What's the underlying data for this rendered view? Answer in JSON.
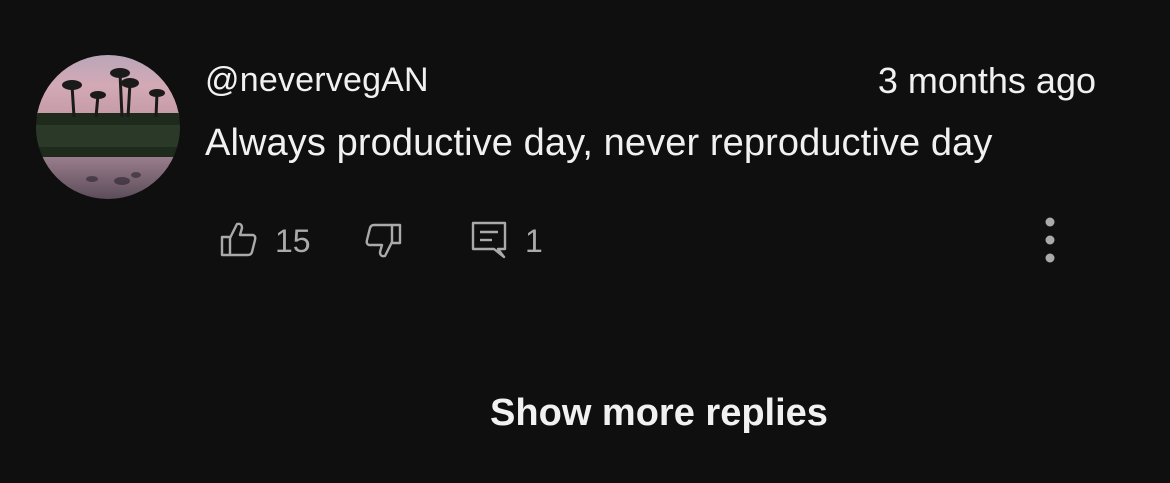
{
  "comment": {
    "author": "@nevervegAN",
    "time": "3 months ago",
    "text": "Always productive day, never reproductive day",
    "avatar_icon": "avatar-palm-trees-sunset",
    "likes": "15",
    "replies": "1"
  },
  "actions": {
    "like_icon": "thumbs-up-icon",
    "dislike_icon": "thumbs-down-icon",
    "reply_icon": "comment-icon",
    "more_icon": "more-vertical-icon"
  },
  "show_more_replies": "Show more replies",
  "colors": {
    "background": "#0f0f0f",
    "primary_text": "#f1f1f1",
    "secondary_text": "#aaaaaa"
  }
}
